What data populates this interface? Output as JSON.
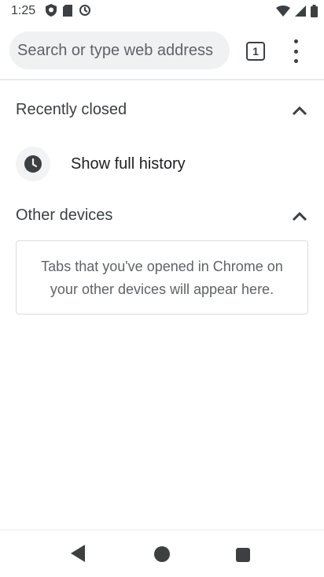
{
  "status_bar": {
    "time": "1:25",
    "left_icons": [
      "shield-icon",
      "sd-card-icon",
      "sync-icon"
    ],
    "right_icons": [
      "wifi-icon",
      "cell-signal-icon",
      "battery-icon"
    ]
  },
  "toolbar": {
    "omnibox_placeholder": "Search or type web address",
    "tab_count": "1",
    "menu_icon": "more-vert-icon"
  },
  "recently_closed": {
    "title": "Recently closed",
    "show_history_label": "Show full history",
    "icon": "clock-icon"
  },
  "other_devices": {
    "title": "Other devices",
    "empty_message": "Tabs that you've opened in Chrome on your other devices will appear here."
  },
  "nav_bar": {
    "icons": [
      "back-icon",
      "home-icon",
      "recents-icon"
    ]
  },
  "colors": {
    "text": "#202124",
    "secondary_text": "#5f6368",
    "omnibox_bg": "#eff1f3",
    "icon": "#3c4043"
  }
}
